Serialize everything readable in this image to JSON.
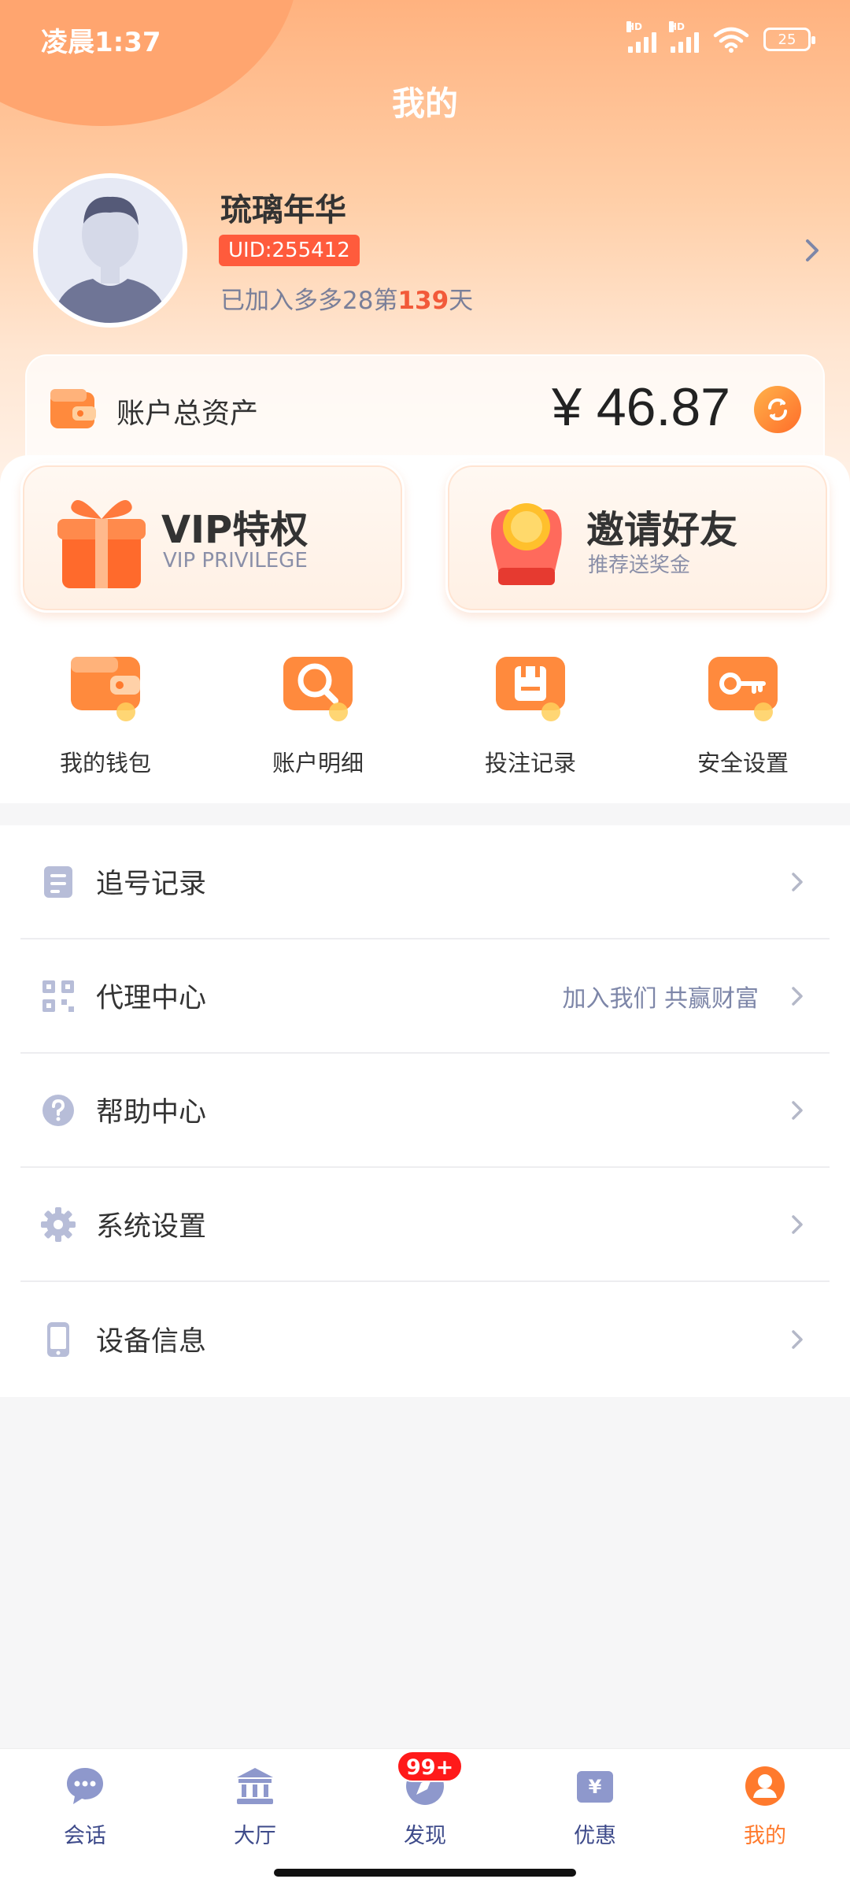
{
  "status_bar": {
    "time": "凌晨1:37",
    "signal_1": "HD",
    "signal_2": "HD",
    "battery": "25"
  },
  "header": {
    "title": "我的"
  },
  "profile": {
    "name": "琉璃年华",
    "uid": "UID:255412",
    "joined_prefix": "已加入多多28第",
    "joined_days": "139",
    "joined_suffix": "天",
    "avatar_icon": "avatar-placeholder"
  },
  "assets": {
    "label": "账户总资产",
    "amount": "¥ 46.87",
    "icons": {
      "wallet": "wallet-icon",
      "refresh": "refresh-icon"
    }
  },
  "promos": [
    {
      "title": "VIP特权",
      "subtitle": "VIP PRIVILEGE",
      "icon": "gift-icon"
    },
    {
      "title": "邀请好友",
      "subtitle": "推荐送奖金",
      "icon": "coin-hand-icon"
    }
  ],
  "quick_actions": [
    {
      "label": "我的钱包",
      "icon": "wallet-icon"
    },
    {
      "label": "账户明细",
      "icon": "search-icon"
    },
    {
      "label": "投注记录",
      "icon": "save-record-icon"
    },
    {
      "label": "安全设置",
      "icon": "key-icon"
    }
  ],
  "menu": [
    {
      "label": "追号记录",
      "extra": "",
      "icon": "document-icon"
    },
    {
      "label": "代理中心",
      "extra": "加入我们 共赢财富",
      "icon": "qr-code-icon"
    },
    {
      "label": "帮助中心",
      "extra": "",
      "icon": "help-icon"
    },
    {
      "label": "系统设置",
      "extra": "",
      "icon": "gear-icon"
    },
    {
      "label": "设备信息",
      "extra": "",
      "icon": "device-icon"
    }
  ],
  "tabbar": {
    "items": [
      {
        "label": "会话",
        "icon": "chat-icon"
      },
      {
        "label": "大厅",
        "icon": "bank-icon"
      },
      {
        "label": "发现",
        "icon": "discover-icon",
        "badge": "99+"
      },
      {
        "label": "优惠",
        "icon": "coupon-icon"
      },
      {
        "label": "我的",
        "icon": "profile-icon",
        "active": true
      }
    ]
  },
  "colors": {
    "accent": "#ff7a2d",
    "badge_red": "#ff1a1a",
    "uid_badge": "#ff5b3c",
    "tab_inactive": "#3d4a8a"
  }
}
